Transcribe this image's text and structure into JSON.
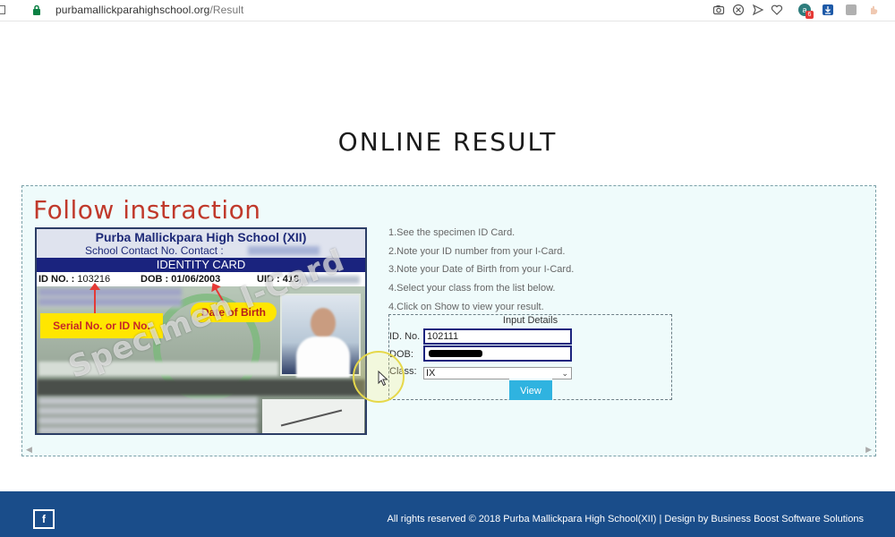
{
  "browser": {
    "url_domain": "purbamallickparahighschool.org",
    "url_path": "/Result",
    "toolbar_icons": [
      "camera-icon",
      "extension-x-icon",
      "send-icon",
      "heart-icon",
      "extension-badge-icon",
      "download-icon",
      "extension-grey-icon",
      "extension-hand-icon"
    ],
    "badge_count": "6"
  },
  "page": {
    "title": "ONLINE RESULT"
  },
  "panel": {
    "heading": "Follow instraction",
    "id_card": {
      "school_name": "Purba Mallickpara High School (XII)",
      "contact_label": "School Contact No. Contact :",
      "band": "IDENTITY CARD",
      "id_label": "ID NO. :",
      "id_value": "103216",
      "dob_label": "DOB :",
      "dob_value": "01/06/2003",
      "uid_label": "UID : 418",
      "uid_tail": "487",
      "serial_tag": "Serial No. or ID No.",
      "dob_tag": "Date of Birth",
      "watermark": "Specimen I-Card"
    },
    "instructions": [
      "1.See the specimen ID Card.",
      "2.Note your ID number from your I-Card.",
      "3.Note your Date of Birth from your I-Card.",
      "4.Select your class from the list below.",
      "4.Click on Show to view your result."
    ],
    "form": {
      "legend": "Input Details",
      "id_label": "ID. No.",
      "id_value": "102111",
      "dob_label": "DOB:",
      "class_label": "Class:",
      "class_value": "IX",
      "view_label": "View"
    }
  },
  "footer": {
    "facebook_glyph": "f",
    "copyright": "All rights reserved © 2018 Purba Mallickpara High School(XII) | Design by Business Boost Software Solutions"
  },
  "colors": {
    "heading_red": "#c0392b",
    "footer_blue": "#1a4d8a",
    "button_blue": "#2fb3e0",
    "panel_bg": "#effbfb"
  }
}
